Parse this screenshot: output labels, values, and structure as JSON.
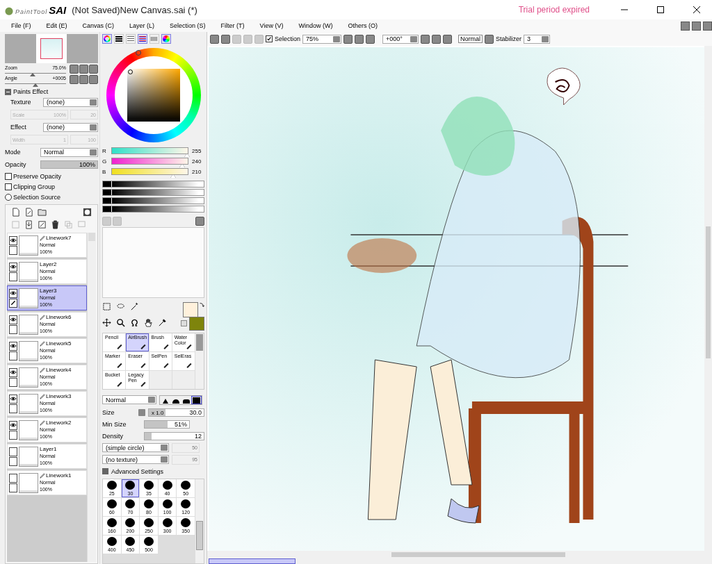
{
  "window": {
    "logo_small": "PaintTool",
    "logo_big": "SAI",
    "title": "(Not Saved)New Canvas.sai (*)",
    "notice": "Trial period expired"
  },
  "menu": [
    "File (F)",
    "Edit (E)",
    "Canvas (C)",
    "Layer (L)",
    "Selection (S)",
    "Filter (T)",
    "View (V)",
    "Window (W)",
    "Others (O)"
  ],
  "navigator": {
    "zoom": {
      "label": "Zoom",
      "value": "75.0%",
      "level": 0.45
    },
    "angle": {
      "label": "Angle",
      "value": "+0005",
      "level": 0.5
    }
  },
  "paints_effect": {
    "title": "Paints Effect",
    "expanded": true,
    "texture_label": "Texture",
    "texture_value": "(none)",
    "scale_label": "Scale",
    "scale_value": "100%",
    "scale_value2": "20",
    "effect_label": "Effect",
    "effect_value": "(none)",
    "width_label": "Width",
    "width_value": "1",
    "width_value2": "100"
  },
  "mode": {
    "label": "Mode",
    "value": "Normal"
  },
  "opacity": {
    "label": "Opacity",
    "value": "100%",
    "level": 1
  },
  "options": [
    {
      "kind": "checkbox",
      "label": "Preserve Opacity",
      "checked": false
    },
    {
      "kind": "checkbox",
      "label": "Clipping Group",
      "checked": false
    },
    {
      "kind": "radio",
      "label": "Selection Source",
      "checked": false
    }
  ],
  "layers": [
    {
      "name": "Linework7",
      "linework": true,
      "blend": "Normal",
      "opacity": "100%",
      "visible": true,
      "selected": false
    },
    {
      "name": "Layer2",
      "linework": false,
      "blend": "Normal",
      "opacity": "100%",
      "visible": true,
      "selected": false
    },
    {
      "name": "Layer3",
      "linework": false,
      "blend": "Normal",
      "opacity": "100%",
      "visible": true,
      "selected": true
    },
    {
      "name": "Linework6",
      "linework": true,
      "blend": "Normal",
      "opacity": "100%",
      "visible": true,
      "selected": false
    },
    {
      "name": "Linework5",
      "linework": true,
      "blend": "Normal",
      "opacity": "100%",
      "visible": true,
      "selected": false
    },
    {
      "name": "Linework4",
      "linework": true,
      "blend": "Normal",
      "opacity": "100%",
      "visible": true,
      "selected": false
    },
    {
      "name": "Linework3",
      "linework": true,
      "blend": "Normal",
      "opacity": "100%",
      "visible": true,
      "selected": false
    },
    {
      "name": "Linework2",
      "linework": true,
      "blend": "Normal",
      "opacity": "100%",
      "visible": true,
      "selected": false
    },
    {
      "name": "Layer1",
      "linework": false,
      "blend": "Normal",
      "opacity": "100%",
      "visible": false,
      "selected": false
    },
    {
      "name": "Linework1",
      "linework": true,
      "blend": "Normal",
      "opacity": "100%",
      "visible": false,
      "selected": false
    }
  ],
  "rgb": [
    {
      "label": "R",
      "value": "255",
      "level": 1
    },
    {
      "label": "G",
      "value": "240",
      "level": 0.94
    },
    {
      "label": "B",
      "value": "210",
      "level": 0.82
    }
  ],
  "brush_tools": [
    {
      "label": "Pencil",
      "selected": false
    },
    {
      "label": "AirBrush",
      "selected": true
    },
    {
      "label": "Brush",
      "selected": false
    },
    {
      "label": "Water Color",
      "selected": false
    },
    {
      "label": "Marker",
      "selected": false
    },
    {
      "label": "Eraser",
      "selected": false
    },
    {
      "label": "SelPen",
      "selected": false
    },
    {
      "label": "SelEras",
      "selected": false
    },
    {
      "label": "Bucket",
      "selected": false
    },
    {
      "label": "Legacy Pen",
      "selected": false
    }
  ],
  "brush": {
    "blend": "Normal",
    "size": {
      "label": "Size",
      "multiplier": "x 1.0",
      "value": "30.0",
      "level": 0.3
    },
    "minsize": {
      "label": "Min Size",
      "value": "51%",
      "level": 0.51
    },
    "density": {
      "label": "Density",
      "value": "12",
      "level": 0.12
    },
    "shape": "(simple circle)",
    "shape_value": "50",
    "texture": "(no texture)",
    "texture_value": "95",
    "advanced": "Advanced Settings"
  },
  "brush_sizes": [
    {
      "label": "25",
      "selected": false
    },
    {
      "label": "30",
      "selected": true
    },
    {
      "label": "35",
      "selected": false
    },
    {
      "label": "40",
      "selected": false
    },
    {
      "label": "50",
      "selected": false
    },
    {
      "label": "60",
      "selected": false
    },
    {
      "label": "70",
      "selected": false
    },
    {
      "label": "80",
      "selected": false
    },
    {
      "label": "100",
      "selected": false
    },
    {
      "label": "120",
      "selected": false
    },
    {
      "label": "160",
      "selected": false
    },
    {
      "label": "200",
      "selected": false
    },
    {
      "label": "250",
      "selected": false
    },
    {
      "label": "300",
      "selected": false
    },
    {
      "label": "350",
      "selected": false
    },
    {
      "label": "400",
      "selected": false
    },
    {
      "label": "450",
      "selected": false
    },
    {
      "label": "500",
      "selected": false
    }
  ],
  "toolbar": {
    "selection_label": "Selection",
    "selection_checked": true,
    "zoom": "75%",
    "angle": "+000°",
    "blend": "Normal",
    "stabilizer_label": "Stabilizer",
    "stabilizer_value": "3"
  }
}
